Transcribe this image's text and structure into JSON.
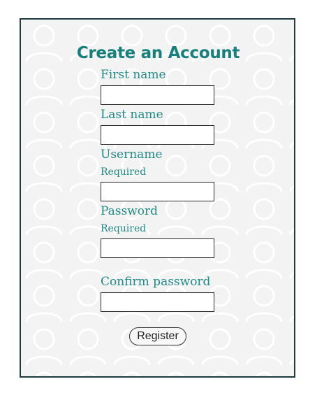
{
  "form": {
    "title": "Create an Account",
    "fields": {
      "first_name": {
        "label": "First name",
        "value": ""
      },
      "last_name": {
        "label": "Last name",
        "value": ""
      },
      "username": {
        "label": "Username",
        "hint": "Required",
        "value": ""
      },
      "password": {
        "label": "Password",
        "hint": "Required",
        "value": ""
      },
      "confirm_password": {
        "label": "Confirm password",
        "value": ""
      }
    },
    "submit_label": "Register"
  },
  "colors": {
    "accent": "#17807d",
    "label": "#1f8a86",
    "border": "#1f3a3d",
    "background": "#f3f3f3"
  },
  "background_pattern_icon": "person-silhouette-icon"
}
